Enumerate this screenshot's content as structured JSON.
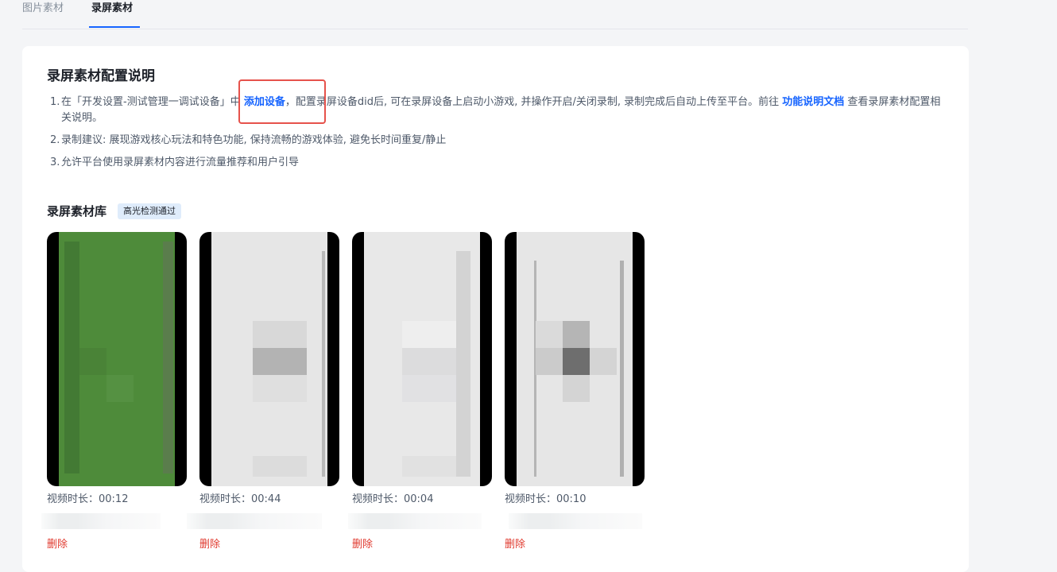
{
  "tabs": [
    "图片素材",
    "录屏素材"
  ],
  "guide": {
    "title": "录屏素材配置说明",
    "item1": {
      "num": "1.",
      "before": "在「开发设置-测试管理一调试设备」中 ",
      "link1": "添加设备",
      "middle": "，配置录屏设备did后, 可在录屏设备上启动小游戏, 并操作开启/关闭录制, 录制完成后自动上传至平台。前往 ",
      "link2": "功能说明文档",
      "after": " 查看录屏素材配置相关说明。"
    },
    "item2": {
      "num": "2.",
      "text": "录制建议: 展现游戏核心玩法和特色功能, 保持流畅的游戏体验, 避免长时间重复/静止"
    },
    "item3": {
      "num": "3.",
      "text": "允许平台使用录屏素材内容进行流量推荐和用户引导"
    }
  },
  "library": {
    "title": "录屏素材库",
    "badge": "高光检测通过",
    "videos": [
      {
        "duration": "视频时长：00:12",
        "delete": "删除"
      },
      {
        "duration": "视频时长：00:44",
        "delete": "删除"
      },
      {
        "duration": "视频时长：00:04",
        "delete": "删除"
      },
      {
        "duration": "视频时长：00:10",
        "delete": "删除"
      }
    ]
  },
  "colors": {
    "accent": "#1664ff",
    "delete": "#e03a2f",
    "highlight_box": "#e6524b"
  }
}
